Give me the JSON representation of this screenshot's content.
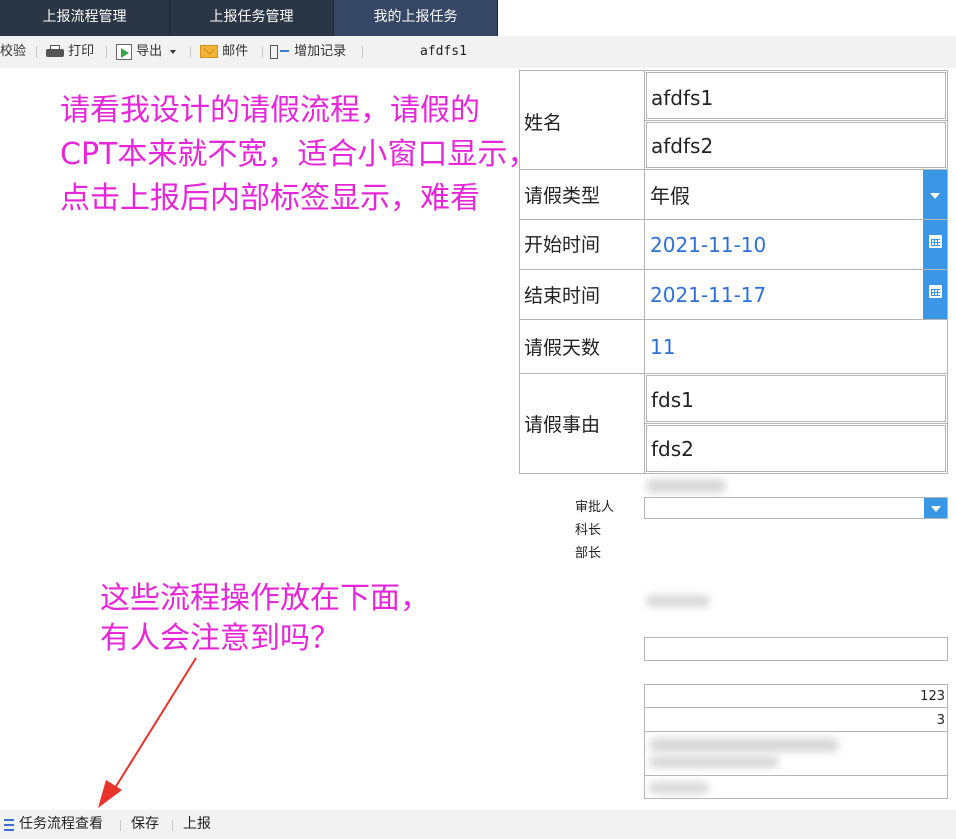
{
  "topnav": {
    "tabs": [
      {
        "label": "上报流程管理"
      },
      {
        "label": "上报任务管理"
      },
      {
        "label": "我的上报任务"
      }
    ]
  },
  "toolbar": {
    "check": "校验",
    "print": "打印",
    "export": "导出",
    "mail": "邮件",
    "add_record": "增加记录",
    "report_name": "afdfs1"
  },
  "annotations": {
    "top": [
      "请看我设计的请假流程，请假的",
      "CPT本来就不宽，适合小窗口显示，",
      "点击上报后内部标签显示，难看"
    ],
    "bottom": [
      "这些流程操作放在下面，",
      "有人会注意到吗？"
    ]
  },
  "form": {
    "name_label": "姓名",
    "name_values": [
      "afdfs1",
      "afdfs2"
    ],
    "leave_type_label": "请假类型",
    "leave_type_value": "年假",
    "start_label": "开始时间",
    "start_value": "2021-11-10",
    "end_label": "结束时间",
    "end_value": "2021-11-17",
    "days_label": "请假天数",
    "days_value": "11",
    "reason_label": "请假事由",
    "reason_values": [
      "fds1",
      "fds2"
    ]
  },
  "approval": {
    "approver_label": "审批人",
    "section_chief": "科长",
    "minister": "部长"
  },
  "small_table": {
    "row1": "123",
    "row2": "3"
  },
  "bottombar": {
    "view_flow": "任务流程查看",
    "save": "保存",
    "report": "上报"
  },
  "colors": {
    "nav_bg": "#2a3546",
    "nav_active": "#354764",
    "annotation": "#e627d9",
    "accent_blue": "#3b97e5",
    "date_text": "#2f6fd8"
  }
}
